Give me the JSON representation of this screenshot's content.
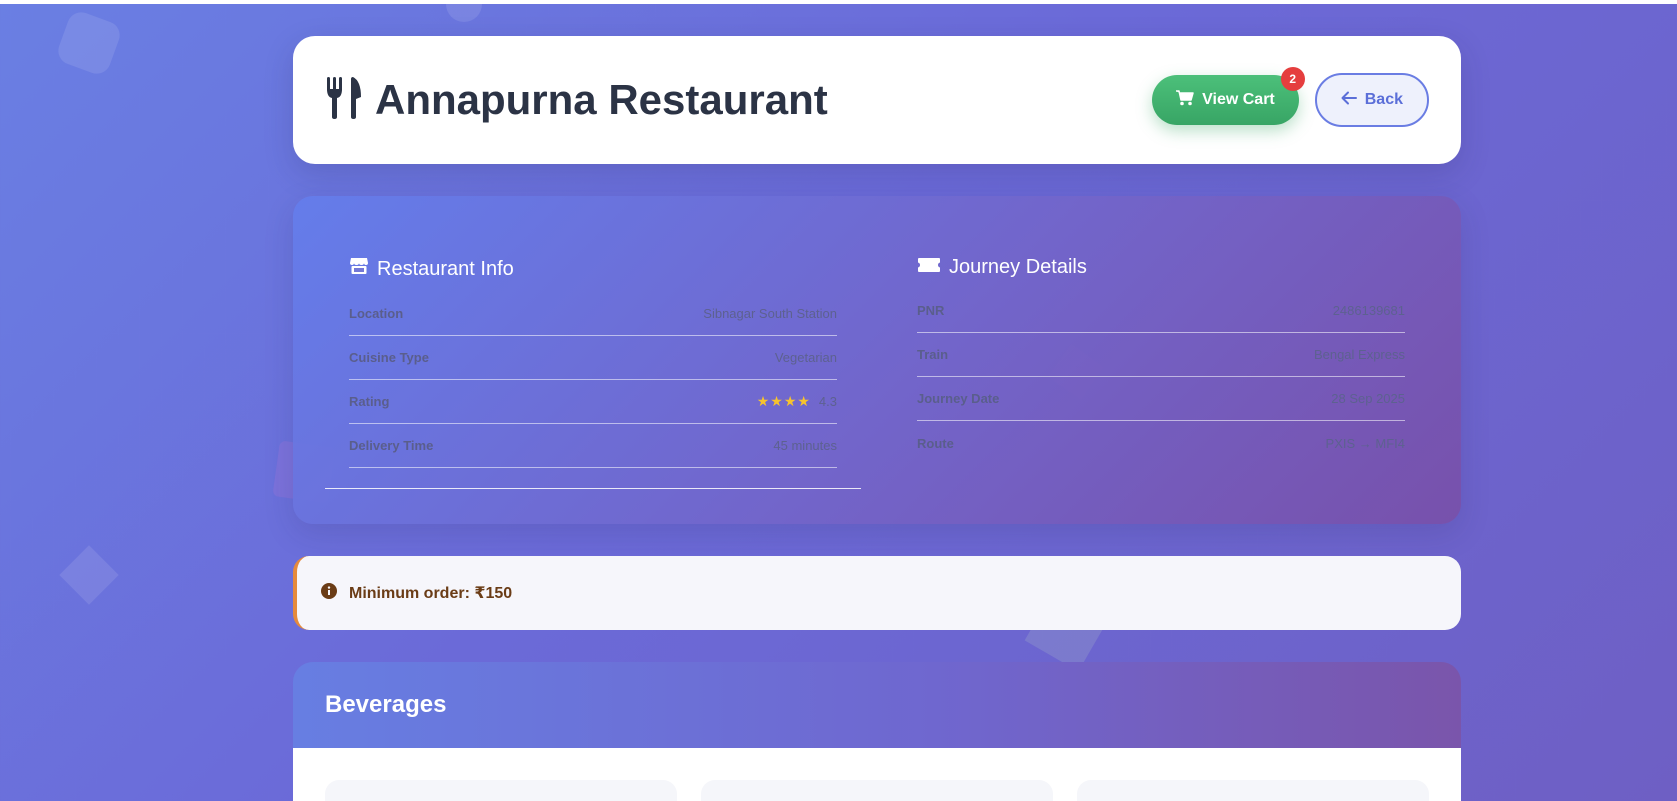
{
  "header": {
    "title": "Annapurna Restaurant",
    "title_icon": "fork-knife-icon",
    "cart_label": "View Cart",
    "cart_count": "2",
    "back_label": "Back"
  },
  "restaurant_info": {
    "heading": "Restaurant Info",
    "rows": [
      {
        "label": "Location",
        "value": "Sibnagar South Station"
      },
      {
        "label": "Cuisine Type",
        "value": "Vegetarian"
      },
      {
        "label": "Rating",
        "stars": "★★★★",
        "value": "4.3"
      },
      {
        "label": "Delivery Time",
        "value": "45 minutes"
      }
    ]
  },
  "journey_details": {
    "heading": "Journey Details",
    "rows": [
      {
        "label": "PNR",
        "value": "2486139681"
      },
      {
        "label": "Train",
        "value": "Bengal Express"
      },
      {
        "label": "Journey Date",
        "value": "28 Sep 2025"
      },
      {
        "label": "Route",
        "value": "PXIS → MFI4"
      }
    ]
  },
  "notice": {
    "text": "Minimum order: ₹150"
  },
  "menu": {
    "section_title": "Beverages"
  },
  "colors": {
    "accent": "#6a7de3",
    "cart_green": "#3fb06e",
    "badge_red": "#e53e3e",
    "notice_border": "#e58a3c"
  }
}
